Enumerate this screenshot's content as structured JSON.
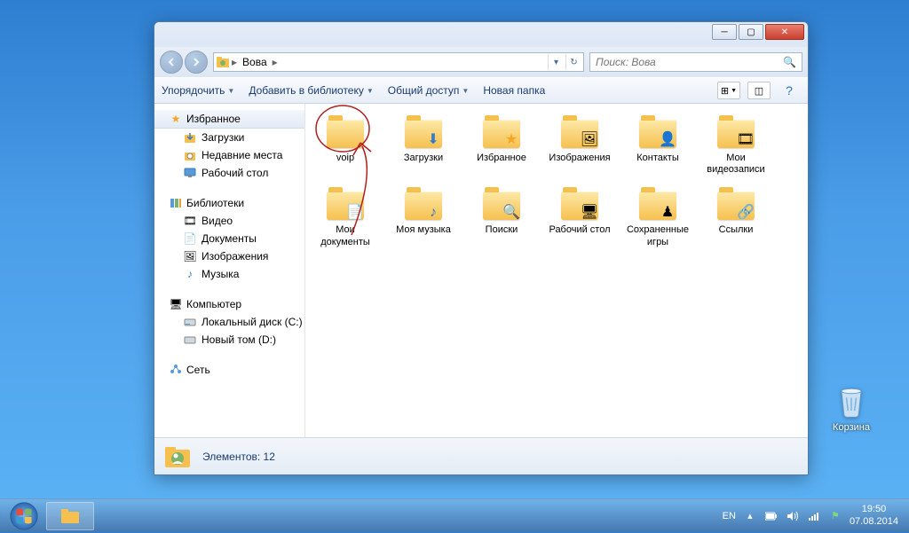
{
  "desktop": {
    "recycle_bin": "Корзина"
  },
  "window": {
    "breadcrumb": {
      "root_icon": "user-folder",
      "path": "Вова"
    },
    "search_placeholder": "Поиск: Вова",
    "toolbar": {
      "organize": "Упорядочить",
      "add_to_library": "Добавить в библиотеку",
      "share": "Общий доступ",
      "new_folder": "Новая папка"
    },
    "sidebar": {
      "favorites": {
        "label": "Избранное",
        "items": [
          {
            "label": "Загрузки",
            "icon": "downloads"
          },
          {
            "label": "Недавние места",
            "icon": "recent"
          },
          {
            "label": "Рабочий стол",
            "icon": "desktop"
          }
        ]
      },
      "libraries": {
        "label": "Библиотеки",
        "items": [
          {
            "label": "Видео",
            "icon": "video"
          },
          {
            "label": "Документы",
            "icon": "documents"
          },
          {
            "label": "Изображения",
            "icon": "pictures"
          },
          {
            "label": "Музыка",
            "icon": "music"
          }
        ]
      },
      "computer": {
        "label": "Компьютер",
        "items": [
          {
            "label": "Локальный диск (C:)",
            "icon": "disk"
          },
          {
            "label": "Новый том (D:)",
            "icon": "disk"
          }
        ]
      },
      "network": {
        "label": "Сеть"
      }
    },
    "files": [
      {
        "name": "voip",
        "overlay": ""
      },
      {
        "name": "Загрузки",
        "overlay": "⬇"
      },
      {
        "name": "Избранное",
        "overlay": "★"
      },
      {
        "name": "Изображения",
        "overlay": "🖼"
      },
      {
        "name": "Контакты",
        "overlay": "👤"
      },
      {
        "name": "Мои видеозаписи",
        "overlay": "🎞"
      },
      {
        "name": "Мои документы",
        "overlay": "📄"
      },
      {
        "name": "Моя музыка",
        "overlay": "♪"
      },
      {
        "name": "Поиски",
        "overlay": "🔍"
      },
      {
        "name": "Рабочий стол",
        "overlay": "🖥"
      },
      {
        "name": "Сохраненные игры",
        "overlay": "♟"
      },
      {
        "name": "Ссылки",
        "overlay": "🔗"
      }
    ],
    "status": {
      "count_label": "Элементов: 12"
    }
  },
  "taskbar": {
    "lang": "EN",
    "time": "19:50",
    "date": "07.08.2014"
  }
}
